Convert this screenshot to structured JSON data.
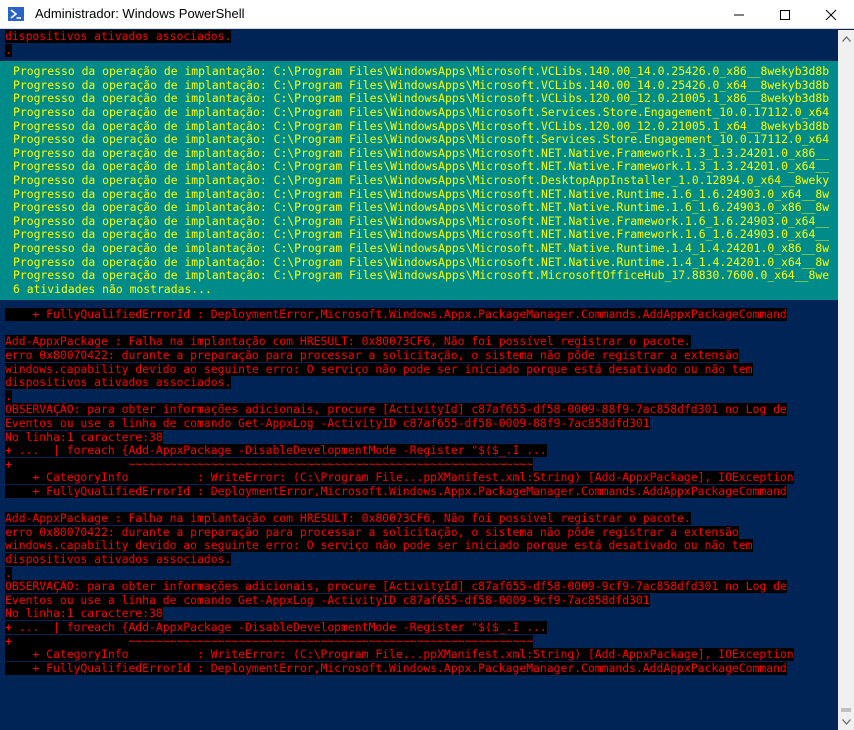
{
  "window": {
    "title": "Administrador: Windows PowerShell",
    "icons": [
      "powershell-icon",
      "minimize-icon",
      "maximize-icon",
      "close-icon"
    ]
  },
  "console": {
    "top_lines": [
      "dispositivos ativados associados.",
      "."
    ],
    "progress": [
      "Progresso da operação de implantação: C:\\Program Files\\WindowsApps\\Microsoft.VCLibs.140.00_14.0.25426.0_x86__8wekyb3d8b",
      "Progresso da operação de implantação: C:\\Program Files\\WindowsApps\\Microsoft.VCLibs.140.00_14.0.25426.0_x64__8wekyb3d8b",
      "Progresso da operação de implantação: C:\\Program Files\\WindowsApps\\Microsoft.VCLibs.120.00_12.0.21005.1_x86__8wekyb3d8b",
      "Progresso da operação de implantação: C:\\Program Files\\WindowsApps\\Microsoft.Services.Store.Engagement_10.0.17112.0_x64",
      "Progresso da operação de implantação: C:\\Program Files\\WindowsApps\\Microsoft.VCLibs.120.00_12.0.21005.1_x64__8wekyb3d8b",
      "Progresso da operação de implantação: C:\\Program Files\\WindowsApps\\Microsoft.Services.Store.Engagement_10.0.17112.0_x64",
      "Progresso da operação de implantação: C:\\Program Files\\WindowsApps\\Microsoft.NET.Native.Framework.1.3_1.3.24201.0_x86__",
      "Progresso da operação de implantação: C:\\Program Files\\WindowsApps\\Microsoft.NET.Native.Framework.1.3_1.3.24201.0_x64__",
      "Progresso da operação de implantação: C:\\Program Files\\WindowsApps\\Microsoft.DesktopAppInstaller_1.0.12894.0_x64__8weky",
      "Progresso da operação de implantação: C:\\Program Files\\WindowsApps\\Microsoft.NET.Native.Runtime.1.6_1.6.24903.0_x64__8w",
      "Progresso da operação de implantação: C:\\Program Files\\WindowsApps\\Microsoft.NET.Native.Runtime.1.6_1.6.24903.0_x86__8w",
      "Progresso da operação de implantação: C:\\Program Files\\WindowsApps\\Microsoft.NET.Native.Framework.1.6_1.6.24903.0_x64__",
      "Progresso da operação de implantação: C:\\Program Files\\WindowsApps\\Microsoft.NET.Native.Framework.1.6_1.6.24903.0_x64__",
      "Progresso da operação de implantação: C:\\Program Files\\WindowsApps\\Microsoft.NET.Native.Runtime.1.4_1.4.24201.0_x86__8w",
      "Progresso da operação de implantação: C:\\Program Files\\WindowsApps\\Microsoft.NET.Native.Runtime.1.4_1.4.24201.0_x64__8w",
      "Progresso da operação de implantação: C:\\Program Files\\WindowsApps\\Microsoft.MicrosoftOfficeHub_17.8830.7600.0_x64__8we",
      "6 atividades não mostradas..."
    ],
    "after_progress": [
      "    + FullyQualifiedErrorId : DeploymentError,Microsoft.Windows.Appx.PackageManager.Commands.AddAppxPackageCommand"
    ],
    "error_block_1": [
      "Add-AppxPackage : Falha na implantação com HRESULT: 0x80073CF6, Não foi possível registrar o pacote.",
      "erro 0x80070422: durante a preparação para processar a solicitação, o sistema não pôde registrar a extensão",
      "windows.capability devido ao seguinte erro: O serviço não pode ser iniciado porque está desativado ou não tem",
      "dispositivos ativados associados.",
      ".",
      "OBSERVAÇÃO: para obter informações adicionais, procure [ActivityId] c87af655-df58-0009-88f9-7ac858dfd301 no Log de",
      "Eventos ou use a linha de comando Get-AppxLog -ActivityID c87af655-df58-0009-88f9-7ac858dfd301",
      "No linha:1 caractere:38",
      "+ ...  | foreach {Add-AppxPackage -DisableDevelopmentMode -Register \"$($_.I ...",
      "+                 ~~~~~~~~~~~~~~~~~~~~~~~~~~~~~~~~~~~~~~~~~~~~~~~~~~~~~~~~~~~",
      "    + CategoryInfo          : WriteError: (C:\\Program File...ppXManifest.xml:String) [Add-AppxPackage], IOException",
      "    + FullyQualifiedErrorId : DeploymentError,Microsoft.Windows.Appx.PackageManager.Commands.AddAppxPackageCommand"
    ],
    "error_block_2": [
      "Add-AppxPackage : Falha na implantação com HRESULT: 0x80073CF6, Não foi possível registrar o pacote.",
      "erro 0x80070422: durante a preparação para processar a solicitação, o sistema não pôde registrar a extensão",
      "windows.capability devido ao seguinte erro: O serviço não pode ser iniciado porque está desativado ou não tem",
      "dispositivos ativados associados.",
      ".",
      "OBSERVAÇÃO: para obter informações adicionais, procure [ActivityId] c87af655-df58-0009-9cf9-7ac858dfd301 no Log de",
      "Eventos ou use a linha de comando Get-AppxLog -ActivityID c87af655-df58-0009-9cf9-7ac858dfd301",
      "No linha:1 caractere:38",
      "+ ...  | foreach {Add-AppxPackage -DisableDevelopmentMode -Register \"$($_.I ...",
      "+                 ~~~~~~~~~~~~~~~~~~~~~~~~~~~~~~~~~~~~~~~~~~~~~~~~~~~~~~~~~~~",
      "    + CategoryInfo          : WriteError: (C:\\Program File...ppXManifest.xml:String) [Add-AppxPackage], IOException",
      "    + FullyQualifiedErrorId : DeploymentError,Microsoft.Windows.Appx.PackageManager.Commands.AddAppxPackageCommand"
    ]
  },
  "colors": {
    "console_bg": "#012456",
    "error_text": "#ff0000",
    "error_bg": "#000000",
    "progress_bg": "#008b8b",
    "progress_text": "#ffff00"
  }
}
